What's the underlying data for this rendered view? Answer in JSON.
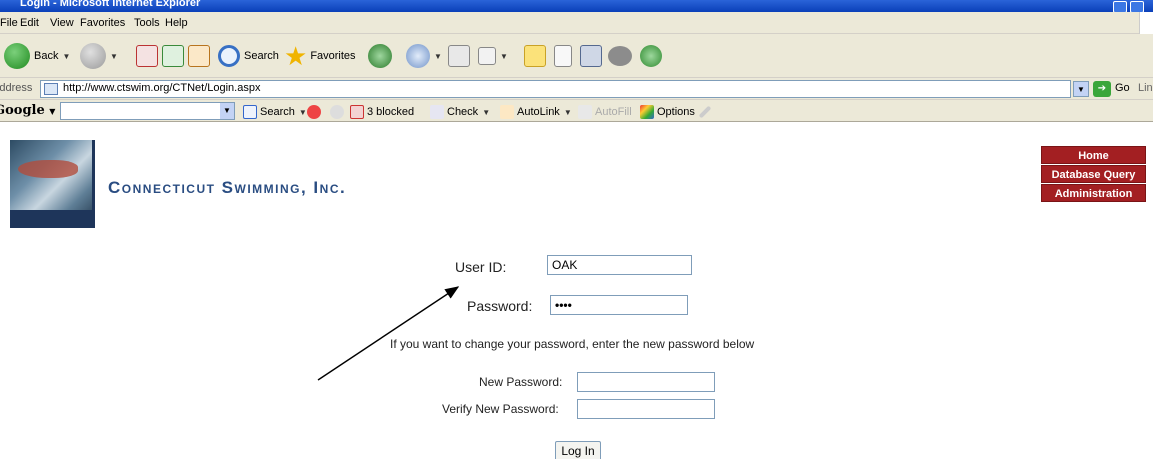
{
  "browser": {
    "title": "Login - Microsoft Internet Explorer",
    "menu": [
      "File",
      "Edit",
      "View",
      "Favorites",
      "Tools",
      "Help"
    ],
    "toolbar": {
      "back_label": "Back",
      "search_label": "Search",
      "favorites_label": "Favorites"
    },
    "address": {
      "label": "Address",
      "url": "http://www.ctswim.org/CTNet/Login.aspx",
      "go_label": "Go",
      "links_label": "Links"
    },
    "google_toolbar": {
      "logo": "Google",
      "search_label": "Search",
      "blocked_label": "3 blocked",
      "check_label": "Check",
      "autolink_label": "AutoLink",
      "autofill_label": "AutoFill",
      "options_label": "Options"
    }
  },
  "page": {
    "site_title": "Connecticut Swimming, Inc.",
    "nav": [
      "Home",
      "Database Query",
      "Administration"
    ],
    "login": {
      "userid_label": "User ID:",
      "userid_value": "OAK",
      "password_label": "Password:",
      "password_value": "••••",
      "info_text": "If you want to change your password, enter the new password below",
      "new_password_label": "New Password:",
      "new_password_value": "",
      "verify_password_label": "Verify New Password:",
      "verify_password_value": "",
      "login_button": "Log In"
    }
  },
  "colors": {
    "nav_red": "#a31f22",
    "title_blue": "#2a4d82"
  }
}
